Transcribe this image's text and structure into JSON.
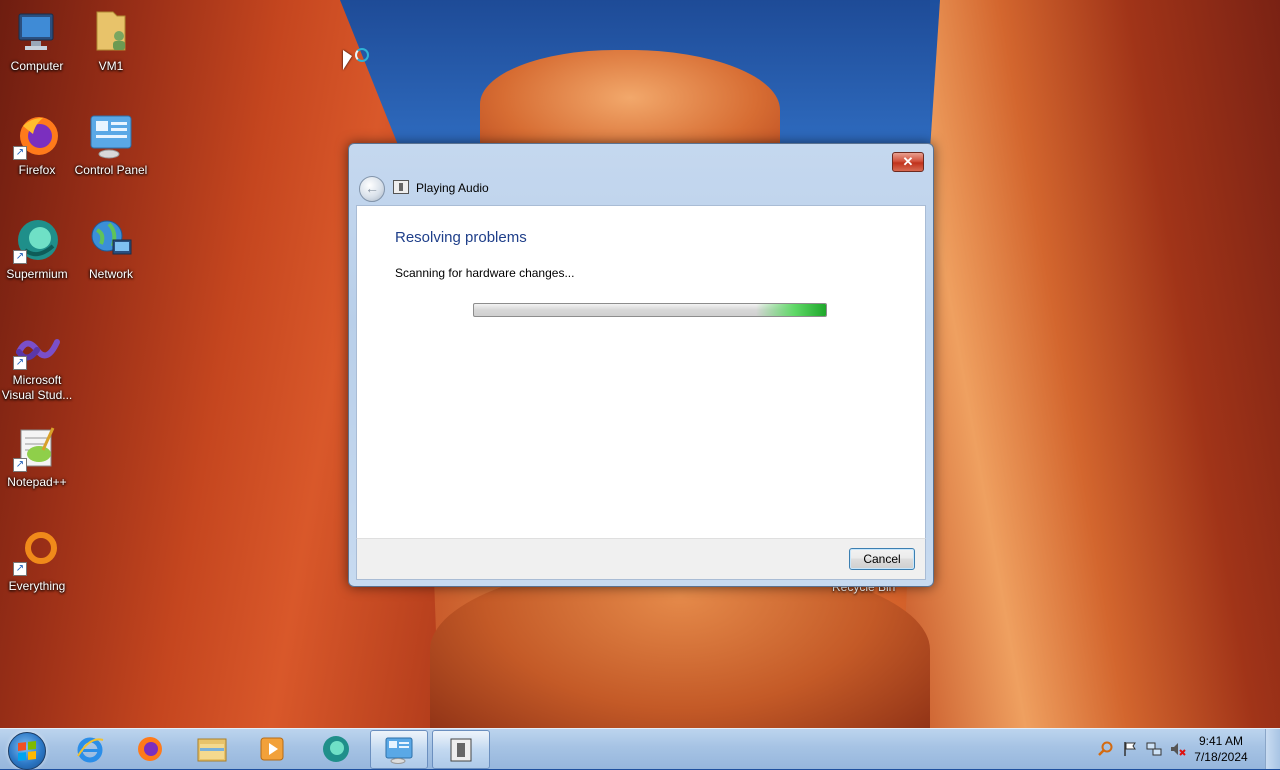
{
  "desktop": {
    "icons": [
      {
        "label": "Computer"
      },
      {
        "label": "VM1"
      },
      {
        "label": "Firefox"
      },
      {
        "label": "Control Panel"
      },
      {
        "label": "Supermium"
      },
      {
        "label": "Network"
      },
      {
        "label": "Microsoft Visual Stud..."
      },
      {
        "label": "Notepad++"
      },
      {
        "label": "Everything"
      }
    ],
    "recycle_bin_label": "Recycle Bin"
  },
  "dialog": {
    "title": "Playing Audio",
    "heading": "Resolving problems",
    "status": "Scanning for hardware changes...",
    "progress_fraction": 0.2,
    "close_symbol": "✕",
    "back_symbol": "←",
    "cancel_label": "Cancel"
  },
  "taskbar": {
    "pinned": [
      "start-button",
      "internet-explorer-icon",
      "firefox-icon",
      "file-explorer-icon",
      "media-player-icon",
      "supermium-icon",
      "control-panel-icon",
      "playing-audio-icon"
    ],
    "tray_icons": [
      "search-icon",
      "flag-icon",
      "network-icon",
      "volume-muted-icon"
    ],
    "clock_time": "9:41 AM",
    "clock_date": "7/18/2024"
  },
  "colors": {
    "heading": "#1f3f8a",
    "progress_green": "#1fa82b",
    "close_red": "#c0321c"
  }
}
